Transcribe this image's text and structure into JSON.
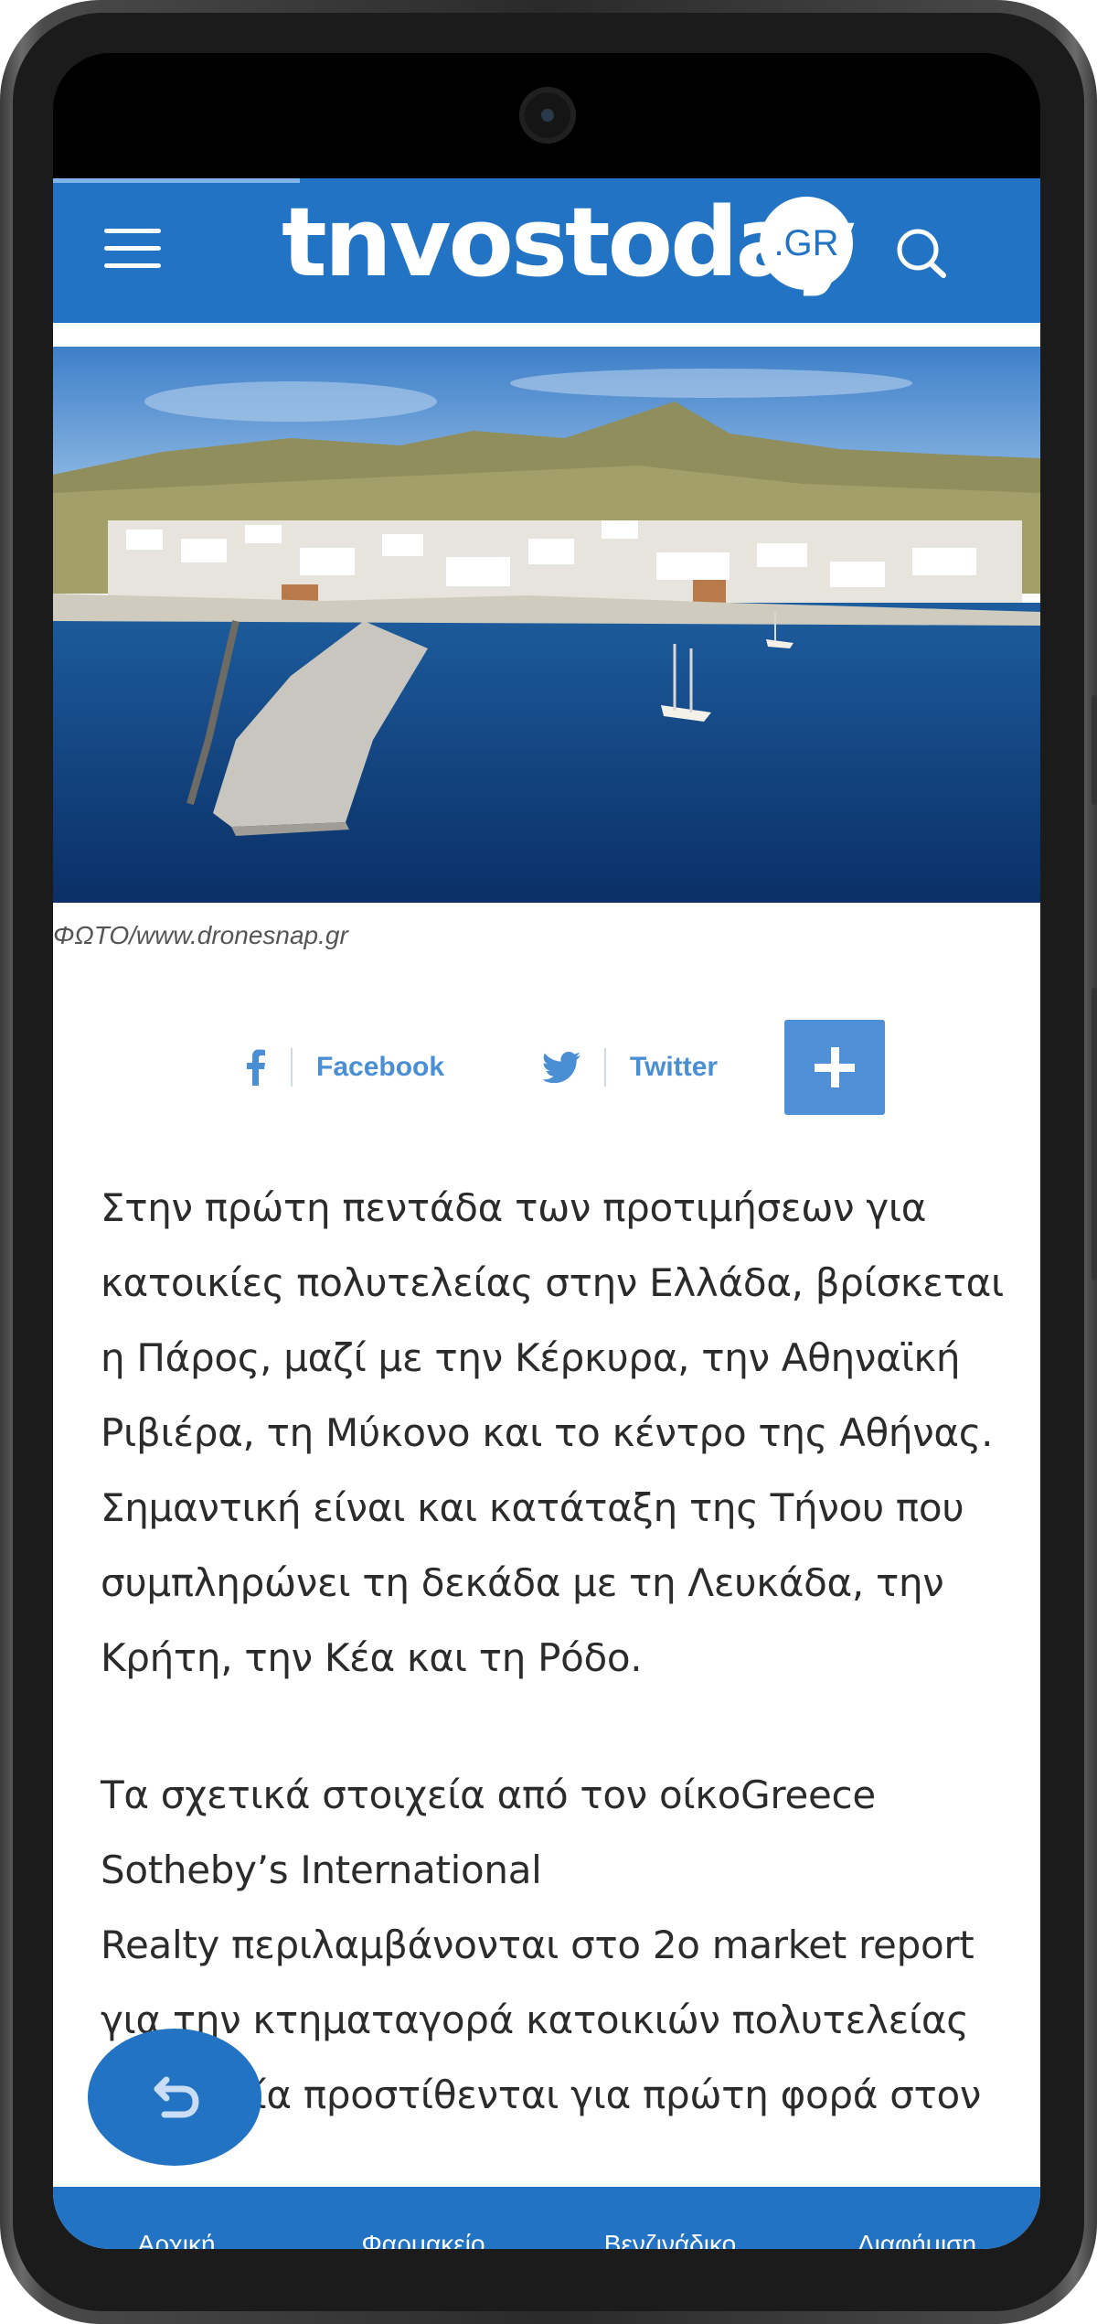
{
  "header": {
    "logo_text": "tnvostoday",
    "logo_suffix": ".GR"
  },
  "photo": {
    "caption": "ΦΩΤΟ/www.dronesnap.gr"
  },
  "share": {
    "facebook_label": "Facebook",
    "twitter_label": "Twitter"
  },
  "article": {
    "paragraph1_lines": [
      "Στην πρώτη πεντάδα των προτιμήσεων για",
      "κατοικίες πολυτελείας στην Ελλάδα, βρίσκεται",
      "η Πάρος, μαζί με την Κέρκυρα, την Αθηναϊκή",
      "Ριβιέρα, τη Μύκονο και το κέντρο της Αθήνας.",
      "Σημαντική είναι και κατάταξη της Τήνου που",
      "συμπληρώνει τη δεκάδα με τη Λευκάδα, την",
      "Κρήτη, την Κέα και τη Ρόδο."
    ],
    "paragraph2_lines": [
      "Τα σχετικά στοιχεία από τον οίκοGreece",
      "Sotheby’s International",
      "Realty περιλαμβάνονται στο 2ο market report",
      "για την κτηματαγορά κατοικιών πολυτελείας",
      "στα οποία προστίθενται για πρώτη φορά στον"
    ]
  },
  "bottom_nav": {
    "items": [
      "Αρχική",
      "Φαρμακείο",
      "Βενζινάδικο",
      "Διαφήμιση"
    ],
    "active_index": 0
  },
  "colors": {
    "brand_blue": "#2273c3",
    "share_blue": "#4a8fd4",
    "active_indicator": "#f2c200"
  }
}
